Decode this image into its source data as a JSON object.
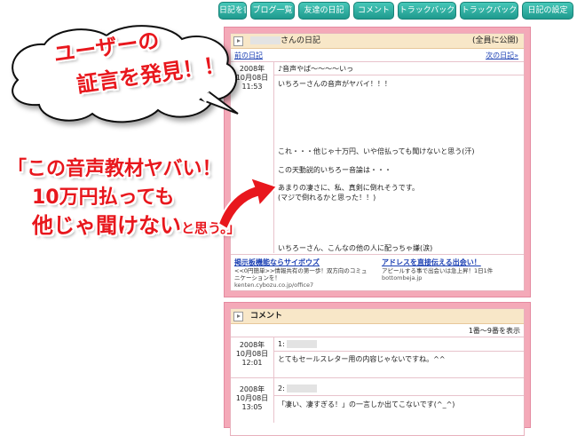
{
  "nav_tabs": [
    "日記を書く",
    "ブログ一覧",
    "友達の日記",
    "コメント",
    "トラックバック",
    "トラックバック",
    "日記の設定"
  ],
  "diary": {
    "owner_suffix": "さんの日記",
    "view_scope": "(全員に公開)",
    "prev_link": "前の日記",
    "next_link": "次の日記»",
    "entry": {
      "date_year": "2008年",
      "date_md": "10月08日",
      "time": "11:53",
      "title": "♪音声やば～～～～いっ",
      "lines": [
        "いちろーさんの音声がヤバイ！！！",
        "これ・・・他じゃ十万円、いや倍払っても聞けないと思う(汗)",
        "この天動説的いちろー音論は・・・",
        "あまりの凄さに、私、真剣に倒れそうです。",
        "(マジで倒れるかと思った！！)",
        "いちろーさん、こんなの他の人に配っちゃ嫌(涙)"
      ]
    },
    "ads": [
      {
        "title": "掲示板機能ならサイボウズ",
        "desc": "<<0円簡単>>情報共有の第一歩！双方向のコミュニケーションを！",
        "url": "kenten.cybozu.co.jp/office7"
      },
      {
        "title": "アドレスを直接伝える出会い！",
        "desc": "アピールする事で出会いは急上昇！1日1件",
        "url": "bottombeja.jp"
      }
    ]
  },
  "comments": {
    "header": "コメント",
    "range": "1番～9番を表示",
    "items": [
      {
        "num": "1:",
        "date_year": "2008年",
        "date_md": "10月08日",
        "time": "12:01",
        "text": "とてもセールスレター用の内容じゃないですね。^^"
      },
      {
        "num": "2:",
        "date_year": "2008年",
        "date_md": "10月08日",
        "time": "13:05",
        "text": "「凄い、凄すぎる！」の一言しか出てこないです(^_^)"
      }
    ]
  },
  "overlay": {
    "bubble_line1": "ユーザーの",
    "bubble_line2": "証言を発見！！",
    "quote_line1": "「この音声教材ヤバい！",
    "quote_line2": "10万円払っても",
    "quote_line3a": "他じゃ聞けない",
    "quote_line3b": "と思う。」"
  },
  "colors": {
    "accent_red": "#e8171d",
    "panel_pink": "#f4a9b8",
    "tab_teal": "#1f9a8e"
  }
}
